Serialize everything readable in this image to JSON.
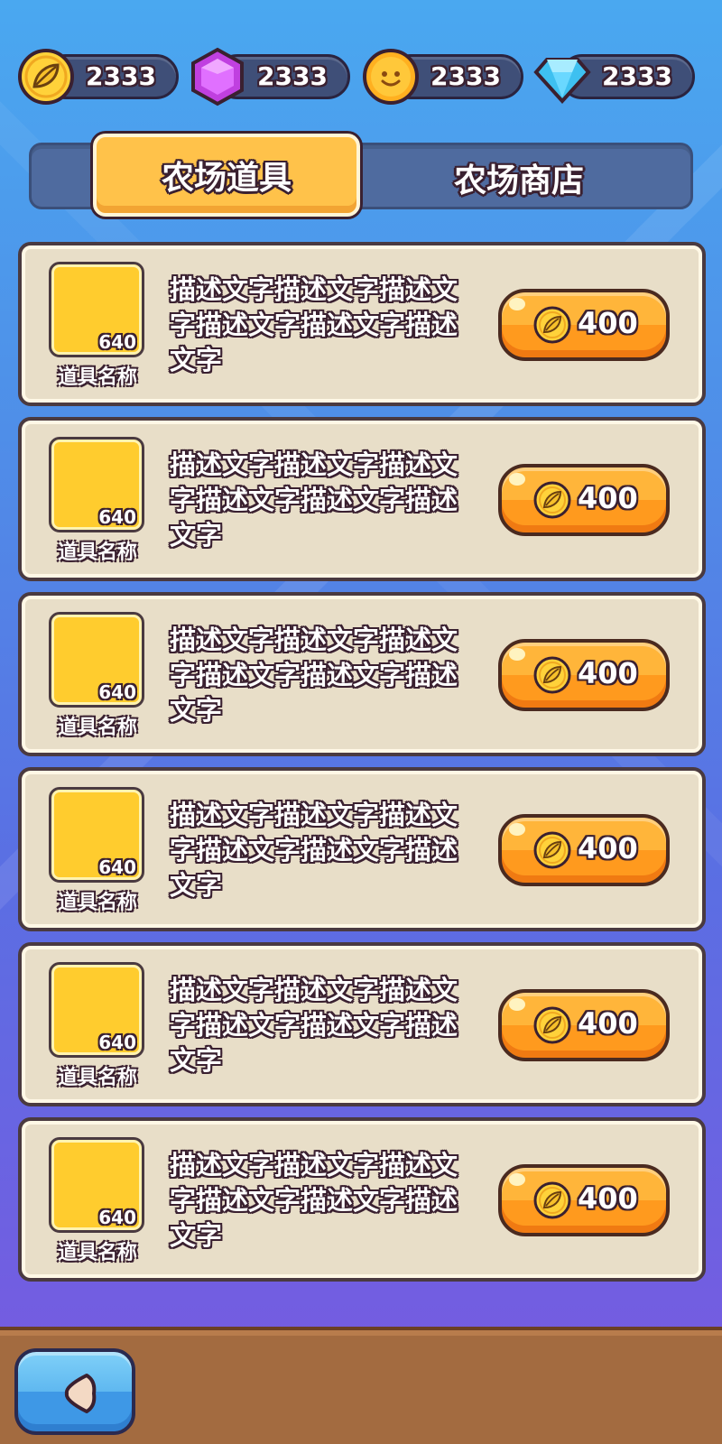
{
  "currencies": [
    {
      "icon": "leaf-coin-icon",
      "value": "2333"
    },
    {
      "icon": "purple-gem-icon",
      "value": "2333"
    },
    {
      "icon": "smiley-coin-icon",
      "value": "2333"
    },
    {
      "icon": "blue-diamond-icon",
      "value": "2333"
    }
  ],
  "tabs": {
    "active_label": "农场道具",
    "inactive_label": "农场商店"
  },
  "items": [
    {
      "count": "640",
      "name": "道具名称",
      "description": "描述文字描述文字描述文字描述文字描述文字描述文字",
      "price": "400"
    },
    {
      "count": "640",
      "name": "道具名称",
      "description": "描述文字描述文字描述文字描述文字描述文字描述文字",
      "price": "400"
    },
    {
      "count": "640",
      "name": "道具名称",
      "description": "描述文字描述文字描述文字描述文字描述文字描述文字",
      "price": "400"
    },
    {
      "count": "640",
      "name": "道具名称",
      "description": "描述文字描述文字描述文字描述文字描述文字描述文字",
      "price": "400"
    },
    {
      "count": "640",
      "name": "道具名称",
      "description": "描述文字描述文字描述文字描述文字描述文字描述文字",
      "price": "400"
    },
    {
      "count": "640",
      "name": "道具名称",
      "description": "描述文字描述文字描述文字描述文字描述文字描述文字",
      "price": "400"
    }
  ],
  "colors": {
    "accent_orange": "#ff9a1e",
    "slot_yellow": "#ffcc2e",
    "card_bg": "#e8dec8",
    "back_blue": "#3e98e6",
    "bottom_brown": "#a36b40"
  },
  "back_button": {
    "icon": "back-arrow-icon"
  }
}
